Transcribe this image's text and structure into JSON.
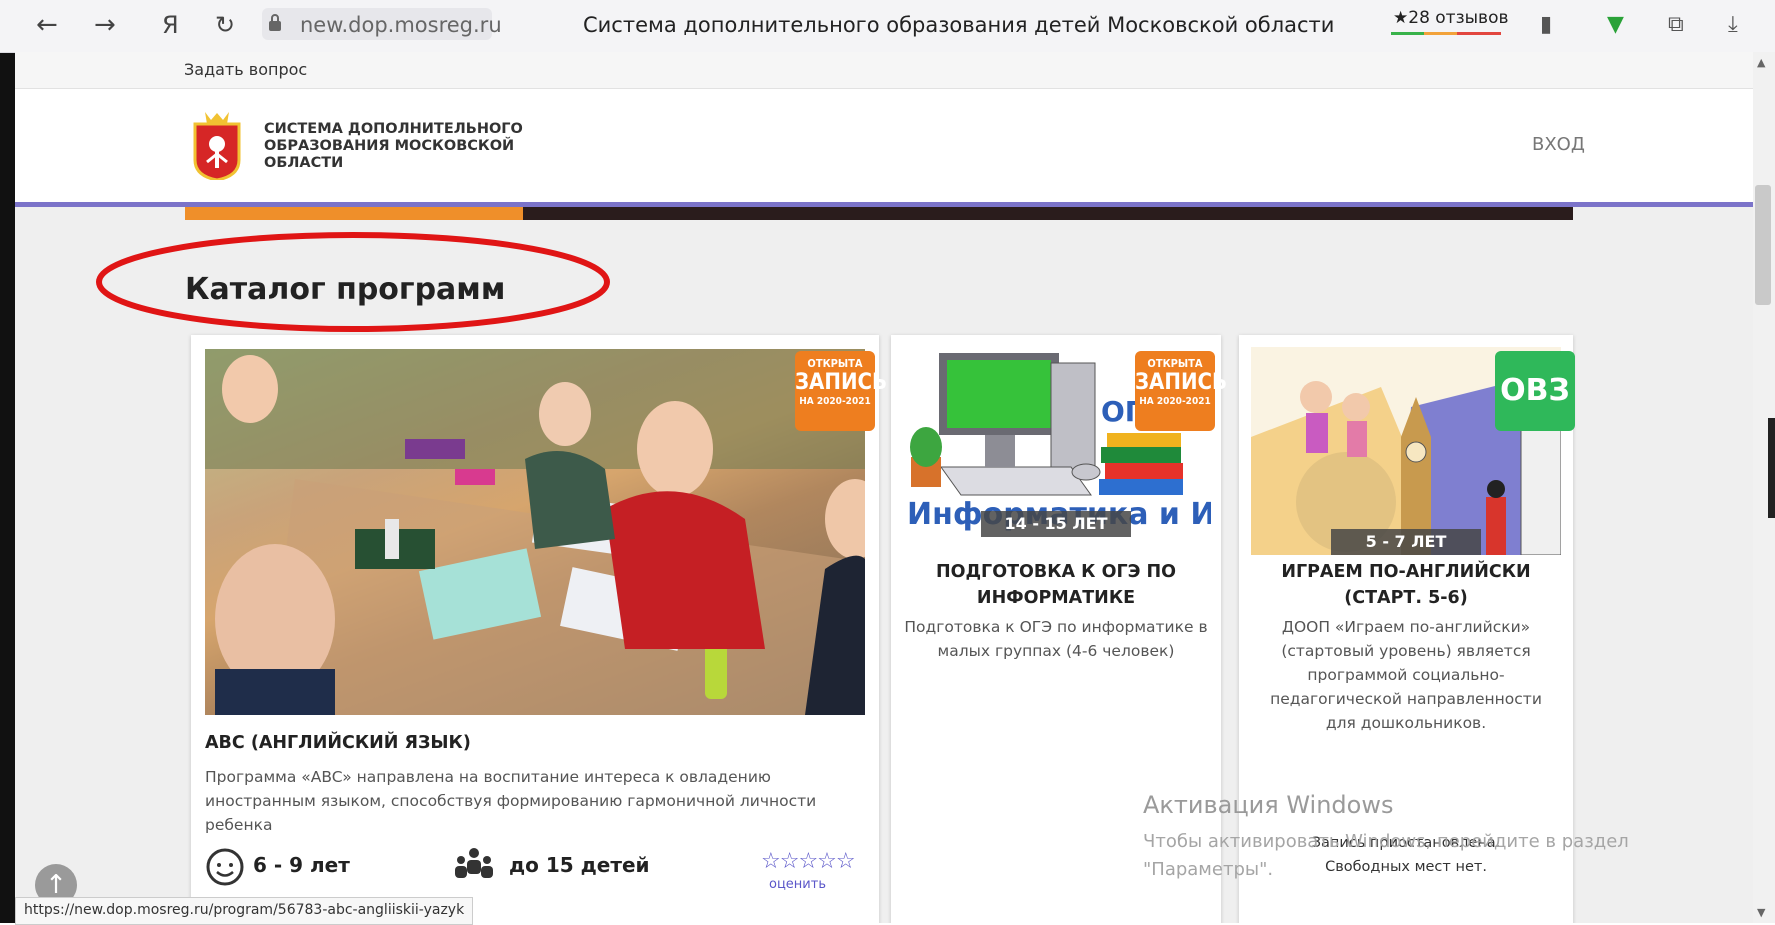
{
  "browser": {
    "url": "new.dop.mosreg.ru",
    "window_title": "Система дополнительного образования детей Московской области",
    "reviews": "28 отзывов",
    "status_url": "https://new.dop.mosreg.ru/program/56783-abc-angliiskii-yazyk"
  },
  "topbar": {
    "ask": "Задать вопрос"
  },
  "header": {
    "brand": "Система дополнительного образования Московской области",
    "login": "ВХОД"
  },
  "catalog": {
    "title": "Каталог программ"
  },
  "badge_open": {
    "line1": "ОТКРЫТА",
    "line2": "ЗАПИСЬ",
    "line3": "НА 2020-2021"
  },
  "cards": [
    {
      "title": "ABC (АНГЛИЙСКИЙ ЯЗЫК)",
      "desc": "Программа «ABC» направлена на воспитание интереса к овладению иностранным языком, способствуя формированию гармоничной личности ребенка",
      "age": "6 - 9 лет",
      "group": "до 15 детей",
      "rate": "оценить"
    },
    {
      "age": "14 - 15 ЛЕТ",
      "title": "ПОДГОТОВКА К ОГЭ ПО ИНФОРМАТИКЕ",
      "desc": "Подготовка к ОГЭ по информатике в малых группах (4-6 человек)",
      "image_text1": "Информатика и ИКТ",
      "image_text2": "ОГЭ"
    },
    {
      "badge": "ОВЗ",
      "age": "5 - 7 ЛЕТ",
      "title": "ИГРАЕМ ПО-АНГЛИЙСКИ (СТАРТ. 5-6)",
      "desc": "ДООП «Играем по-английски» (стартовый уровень) является программой социально-педагогической направленности для дошкольников.",
      "note1": "Запись приостановлена.",
      "note2": "Свободных мест нет."
    }
  ],
  "watermark": {
    "line1": "Активация Windows",
    "line2": "Чтобы активировать Windows, перейдите в раздел \"Параметры\"."
  },
  "colors": {
    "orange": "#ee7e1f",
    "green": "#2fb85a",
    "purple": "#7b73c9",
    "red_ellipse": "#e01515"
  }
}
